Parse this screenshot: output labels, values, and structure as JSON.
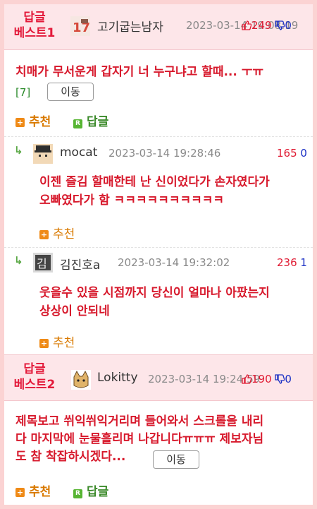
{
  "best1": {
    "label_line1": "답글",
    "label_line2": "베스트1",
    "nick": "고기굽는남자",
    "date": "2023-03-14 19:08:19",
    "up": "249",
    "down": "0",
    "title": "치매가 무서운게 갑자기 너 누구냐고 할때... ㅜㅠ",
    "count": "[7]",
    "move_label": "이동",
    "recommend_label": "추천",
    "reply_label": "답글"
  },
  "replies": [
    {
      "nick": "mocat",
      "date": "2023-03-14 19:28:46",
      "up": "165",
      "down": "0",
      "text_line1": "이젠 즐김 할매한테 난 신이었다가 손자였다가",
      "text_line2": "오빠였다가 함 ㅋㅋㅋㅋㅋㅋㅋㅋㅋㅋ",
      "recommend_label": "추천"
    },
    {
      "nick": "김진호a",
      "date": "2023-03-14 19:32:02",
      "up": "236",
      "down": "1",
      "text_line1": "웃을수 있을 시점까지 당신이 얼마나 아팠는지",
      "text_line2": "상상이 안되네",
      "recommend_label": "추천"
    }
  ],
  "best2": {
    "label_line1": "답글",
    "label_line2": "베스트2",
    "nick": "Lokitty",
    "date": "2023-03-14 19:24:59",
    "up": "190",
    "down": "0",
    "title_line1": "제목보고 쒸익쒸익거리며 들어와서 스크롤을 내리",
    "title_line2": "다 마지막에 눈물흘리며 나갑니다ㅠㅠㅠ 제보자님",
    "title_line3": "도 참 착잡하시겠다...",
    "move_label": "이동",
    "recommend_label": "추천",
    "reply_label": "답글"
  },
  "icons": {
    "reply_arrow": "reply-arrow-icon",
    "thumb_up": "thumbs-up-icon",
    "thumb_down": "thumbs-down-icon",
    "plus": "plus-icon",
    "reply_badge": "reply-badge-icon"
  },
  "colors": {
    "accent_red": "#e31a3a",
    "up_red": "#e01b33",
    "down_blue": "#1a2fc4",
    "orange": "#d97a00",
    "green": "#3b8a2a",
    "border_pink": "#fbd3d3"
  }
}
